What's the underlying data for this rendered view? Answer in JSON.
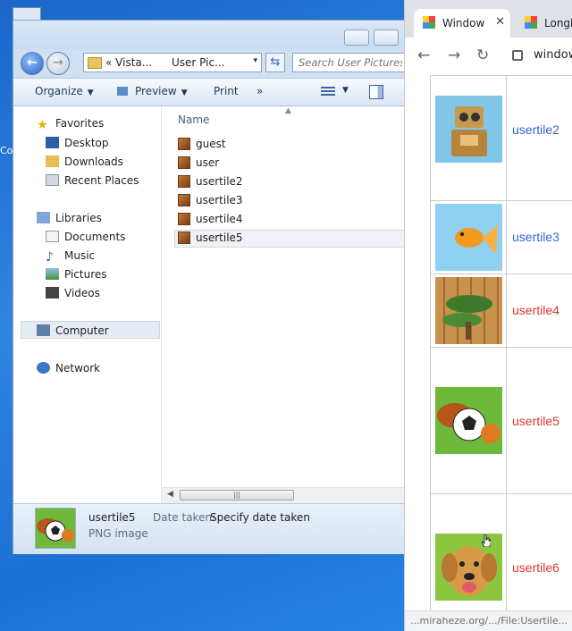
{
  "desktop": {
    "icon_label": "Co"
  },
  "explorer": {
    "address": {
      "crumb_prefix": "«",
      "crumb1": "Vista...",
      "crumb2": "User Pic...",
      "dropdown": "▾"
    },
    "search_placeholder": "Search User Pictures",
    "toolbar": {
      "organize": "Organize",
      "preview": "Preview",
      "print": "Print",
      "more": "»"
    },
    "nav": {
      "favorites": "Favorites",
      "desktop": "Desktop",
      "downloads": "Downloads",
      "recent": "Recent Places",
      "libraries": "Libraries",
      "documents": "Documents",
      "music": "Music",
      "pictures": "Pictures",
      "videos": "Videos",
      "computer": "Computer",
      "network": "Network"
    },
    "column_header": "Name",
    "files": [
      "guest",
      "user",
      "usertile2",
      "usertile3",
      "usertile4",
      "usertile5"
    ],
    "selected_file": "usertile5",
    "details": {
      "name": "usertile5",
      "type": "PNG image",
      "date_label": "Date taken:",
      "date_value": "Specify date taken"
    }
  },
  "browser": {
    "tabs": [
      {
        "title": "Window",
        "active": true
      },
      {
        "title": "Longh",
        "active": false
      }
    ],
    "url": "window",
    "rows": [
      {
        "label": "usertile2",
        "color": "#3366cc",
        "image": "robot"
      },
      {
        "label": "usertile3",
        "color": "#3366cc",
        "image": "goldfish"
      },
      {
        "label": "usertile4",
        "color": "#dd3333",
        "image": "bonsai"
      },
      {
        "label": "usertile5",
        "color": "#dd3333",
        "image": "sports-balls"
      },
      {
        "label": "usertile6",
        "color": "#dd3333",
        "image": "puppy"
      }
    ],
    "status": "...miraheze.org/.../File:Usertile..."
  }
}
